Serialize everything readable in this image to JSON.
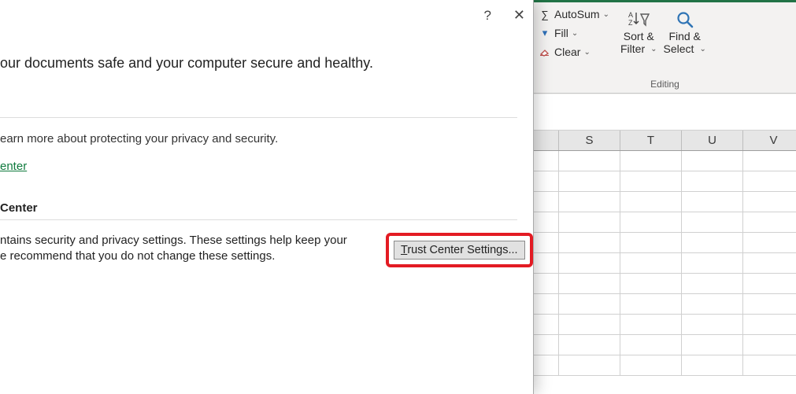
{
  "ribbon": {
    "autosum": "AutoSum",
    "fill": "Fill",
    "clear": "Clear",
    "sort_filter_l1": "Sort &",
    "sort_filter_l2": "Filter",
    "find_select_l1": "Find &",
    "find_select_l2": "Select",
    "group": "Editing"
  },
  "sheet": {
    "columns": [
      "S",
      "T",
      "U",
      "V"
    ]
  },
  "dialog": {
    "help": "?",
    "close": "✕",
    "intro": "our documents safe and your computer secure and healthy.",
    "privacy_sub": "earn more about protecting your privacy and security.",
    "privacy_link": "enter",
    "section_head": "Center",
    "body_l1": "ntains security and privacy settings. These settings help keep your",
    "body_l2": "e recommend that you do not change these settings.",
    "tc_button_prefix": "T",
    "tc_button_rest": "rust Center Settings..."
  }
}
